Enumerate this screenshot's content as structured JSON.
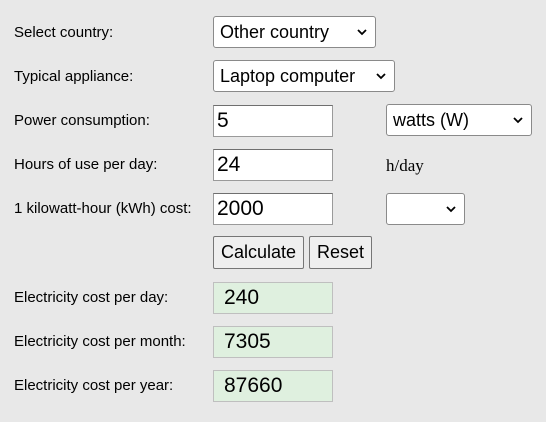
{
  "form": {
    "country": {
      "label": "Select country:",
      "value": "Other country"
    },
    "appliance": {
      "label": "Typical appliance:",
      "value": "Laptop computer"
    },
    "power": {
      "label": "Power consumption:",
      "value": "5",
      "unit": "watts (W)"
    },
    "hours": {
      "label": "Hours of use per day:",
      "value": "24",
      "unit": "h/day"
    },
    "cost": {
      "label": "1 kilowatt-hour (kWh) cost:",
      "value": "2000",
      "currency": ""
    }
  },
  "buttons": {
    "calculate": "Calculate",
    "reset": "Reset"
  },
  "results": {
    "day": {
      "label": "Electricity cost per day:",
      "value": "240"
    },
    "month": {
      "label": "Electricity cost per month:",
      "value": "7305"
    },
    "year": {
      "label": "Electricity cost per year:",
      "value": "87660"
    }
  },
  "colors": {
    "page_background": "#e8e8e8",
    "result_background": "#dff0df"
  }
}
